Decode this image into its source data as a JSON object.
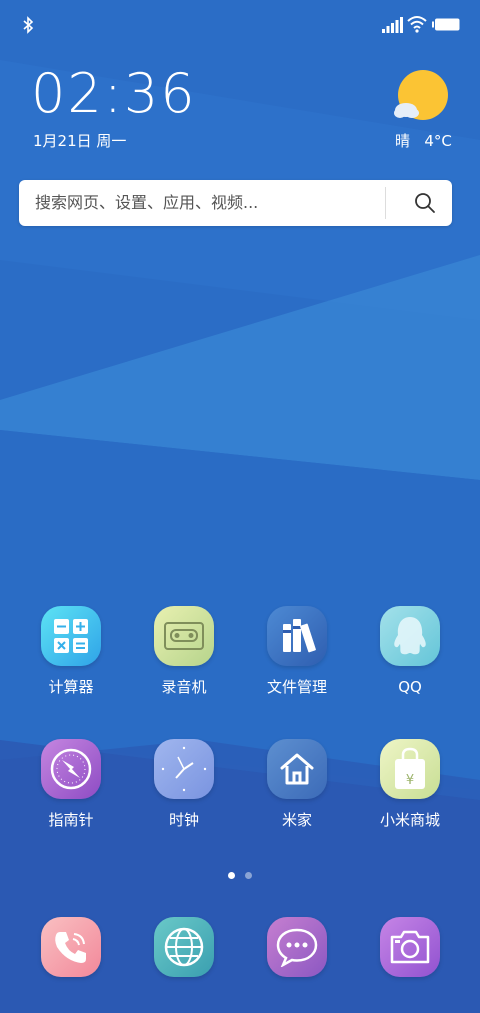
{
  "status_bar": {
    "icons": [
      "bluetooth-icon",
      "cellular-signal-icon",
      "wifi-icon",
      "battery-icon"
    ]
  },
  "lock_info": {
    "time": "02:36",
    "date": "1月21日 周一"
  },
  "weather": {
    "condition": "晴",
    "temperature": "4°C",
    "icon": "sun-cloud-icon"
  },
  "search": {
    "placeholder": "搜索网页、设置、应用、视频...",
    "icon": "search-icon"
  },
  "apps": {
    "calculator": {
      "label": "计算器",
      "icon": "calculator-icon"
    },
    "recorder": {
      "label": "录音机",
      "icon": "cassette-icon"
    },
    "files": {
      "label": "文件管理",
      "icon": "books-icon"
    },
    "qq": {
      "label": "QQ",
      "icon": "penguin-icon"
    },
    "compass": {
      "label": "指南针",
      "icon": "compass-icon"
    },
    "clock": {
      "label": "时钟",
      "icon": "clock-icon"
    },
    "mijia": {
      "label": "米家",
      "icon": "home-icon"
    },
    "mistore": {
      "label": "小米商城",
      "icon": "shopping-bag-icon"
    }
  },
  "page_indicator": {
    "current": 1,
    "total": 2
  },
  "dock": {
    "phone": {
      "icon": "phone-icon"
    },
    "browser": {
      "icon": "globe-icon"
    },
    "messages": {
      "icon": "chat-bubble-icon"
    },
    "camera": {
      "icon": "camera-icon"
    }
  },
  "colors": {
    "background": "#2a6bc4",
    "accent_light": "#3a86d6",
    "sun": "#fbc434"
  }
}
